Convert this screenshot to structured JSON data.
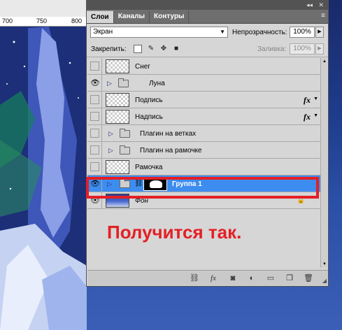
{
  "ruler": {
    "marks": [
      "700",
      "750",
      "800"
    ]
  },
  "panel": {
    "topbar": {
      "collapse": "◂◂",
      "close": "✕"
    },
    "tabs": [
      {
        "label": "Слои",
        "active": true
      },
      {
        "label": "Каналы",
        "active": false
      },
      {
        "label": "Контуры",
        "active": false
      }
    ],
    "menu_icon": "≡",
    "blend_mode": "Экран",
    "opacity_label": "Непрозрачность:",
    "opacity_value": "100%",
    "lock_label": "Закрепить:",
    "fill_label": "Заливка:",
    "fill_value": "100%"
  },
  "layers": [
    {
      "name": "Снег",
      "visible": false,
      "type": "layer"
    },
    {
      "name": "Луна",
      "visible": true,
      "type": "group"
    },
    {
      "name": "Подпись",
      "visible": false,
      "type": "layer",
      "fx": "fx"
    },
    {
      "name": "Надпись",
      "visible": false,
      "type": "layer",
      "fx": "fx"
    },
    {
      "name": "Плагин на ветках",
      "visible": false,
      "type": "group"
    },
    {
      "name": "Плагин на рамочке",
      "visible": false,
      "type": "group"
    },
    {
      "name": "Рамочка",
      "visible": false,
      "type": "layer"
    },
    {
      "name": "Группа 1",
      "visible": true,
      "type": "group",
      "selected": true
    },
    {
      "name": "Фон",
      "visible": true,
      "type": "background",
      "locked": true
    }
  ],
  "caption": "Получится так.",
  "bottom_icons": [
    "link-icon",
    "fx-icon",
    "mask-icon",
    "adjustment-icon",
    "folder-icon",
    "new-layer-icon",
    "trash-icon"
  ]
}
